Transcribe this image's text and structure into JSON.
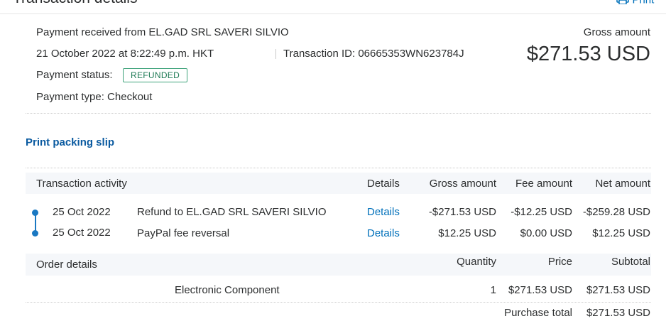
{
  "header": {
    "title": "Transaction details",
    "print_label": "Print"
  },
  "summary": {
    "payment_received": "Payment received from EL.GAD SRL SAVERI SILVIO",
    "datetime": "21 October 2022 at 8:22:49 p.m. HKT",
    "transaction_id": "Transaction ID: 06665353WN623784J",
    "status_label": "Payment status:",
    "status_value": "REFUNDED",
    "payment_type": "Payment type: Checkout",
    "gross_label": "Gross amount",
    "gross_value": "$271.53 USD"
  },
  "print_packing_slip": "Print packing slip",
  "activity": {
    "headers": [
      "Transaction activity",
      "Details",
      "Gross amount",
      "Fee amount",
      "Net amount"
    ],
    "rows": [
      {
        "date": "25 Oct 2022",
        "desc": "Refund to EL.GAD SRL SAVERI SILVIO",
        "details": "Details",
        "gross": "-$271.53 USD",
        "fee": "-$12.25 USD",
        "net": "-$259.28 USD"
      },
      {
        "date": "25 Oct 2022",
        "desc": "PayPal fee reversal",
        "details": "Details",
        "gross": "$12.25 USD",
        "fee": "$0.00 USD",
        "net": "$12.25 USD"
      }
    ]
  },
  "order": {
    "headers": [
      "Order details",
      "Quantity",
      "Price",
      "Subtotal"
    ],
    "items": [
      {
        "name": "Electronic Component",
        "quantity": "1",
        "price": "$271.53 USD",
        "subtotal": "$271.53 USD"
      }
    ],
    "purchase_total_label": "Purchase total",
    "purchase_total_value": "$271.53 USD"
  },
  "colors": {
    "link": "#0070ba",
    "badge_border": "#3fa37b",
    "timeline": "#1a78c2"
  }
}
